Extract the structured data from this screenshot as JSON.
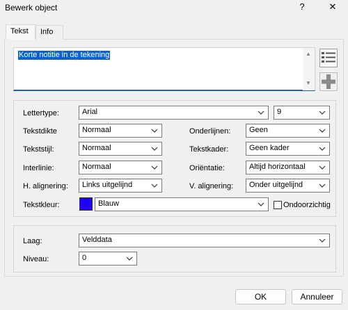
{
  "window": {
    "title": "Bewerk object",
    "help_label": "?",
    "close_label": "✕"
  },
  "tabs": [
    {
      "label": "Tekst"
    },
    {
      "label": "Info"
    }
  ],
  "text_area": {
    "value": "Korte notitie in de tekening"
  },
  "font": {
    "labels": {
      "font": "Lettertype:",
      "weight": "Tekstdikte",
      "style": "Tekststijl:",
      "spacing": "Interlinie:",
      "halign": "H. alignering:",
      "color": "Tekstkleur:",
      "underline": "Onderlijnen:",
      "frame": "Tekstkader:",
      "orientation": "Oriëntatie:",
      "valign": "V. alignering:"
    },
    "values": {
      "font": "Arial",
      "size": "9",
      "weight": "Normaal",
      "style": "Normaal",
      "spacing": "Normaal",
      "halign": "Links uitgelijnd",
      "color": "Blauw",
      "underline": "Geen",
      "frame": "Geen kader",
      "orientation": "Altijd horizontaal",
      "valign": "Onder uitgelijnd"
    },
    "color_hex": "#2000ff",
    "opaque_label": "Ondoorzichtig",
    "opaque_checked": false
  },
  "layer": {
    "labels": {
      "layer": "Laag:",
      "level": "Niveau:"
    },
    "values": {
      "layer": "Velddata",
      "level": "0"
    }
  },
  "buttons": {
    "ok": "OK",
    "cancel": "Annuleer"
  }
}
